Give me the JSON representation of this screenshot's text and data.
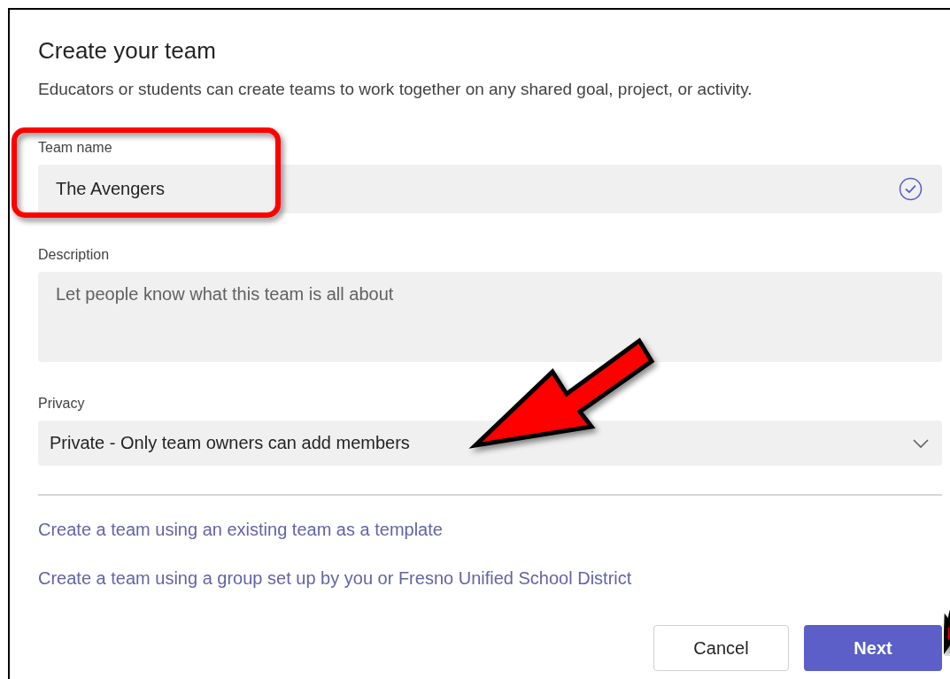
{
  "dialog": {
    "title": "Create your team",
    "subtitle": "Educators or students can create teams to work together on any shared goal, project, or activity."
  },
  "fields": [
    {
      "kind": "text",
      "label": "Team name",
      "value": "The Avengers",
      "validated": true
    },
    {
      "kind": "textarea",
      "label": "Description",
      "placeholder": "Let people know what this team is all about"
    },
    {
      "kind": "select",
      "label": "Privacy",
      "value": "Private - Only team owners can add members"
    }
  ],
  "links": [
    "Create a team using an existing team as a template",
    "Create a team using a group set up by you or Fresno Unified School District"
  ],
  "buttons": [
    {
      "label": "Cancel",
      "kind": "secondary"
    },
    {
      "label": "Next",
      "kind": "primary"
    }
  ]
}
